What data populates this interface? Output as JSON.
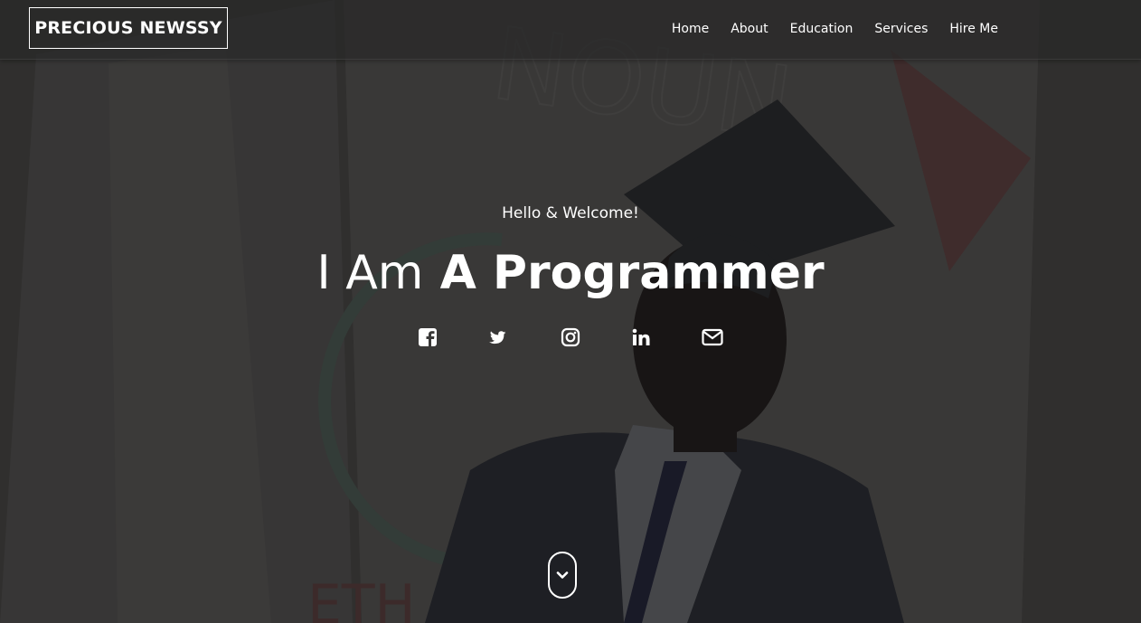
{
  "brand": {
    "name": "PRECIOUS NEWSSY"
  },
  "nav": {
    "items": [
      {
        "label": "Home"
      },
      {
        "label": "About"
      },
      {
        "label": "Education"
      },
      {
        "label": "Services"
      },
      {
        "label": "Hire Me"
      }
    ]
  },
  "hero": {
    "greeting": "Hello & Welcome!",
    "headline_prefix": "I Am",
    "headline_emphasis": "A Programmer",
    "background_sign_text": "NOUN",
    "background_sign_bottom": "ETH"
  },
  "socials": [
    {
      "icon": "facebook-icon"
    },
    {
      "icon": "twitter-icon"
    },
    {
      "icon": "instagram-icon"
    },
    {
      "icon": "linkedin-icon"
    },
    {
      "icon": "envelope-icon"
    }
  ],
  "scroll": {
    "icon": "chevron-down-icon"
  },
  "colors": {
    "overlay": "#3a3938",
    "text": "#ffffff",
    "navbar": "#282828"
  }
}
